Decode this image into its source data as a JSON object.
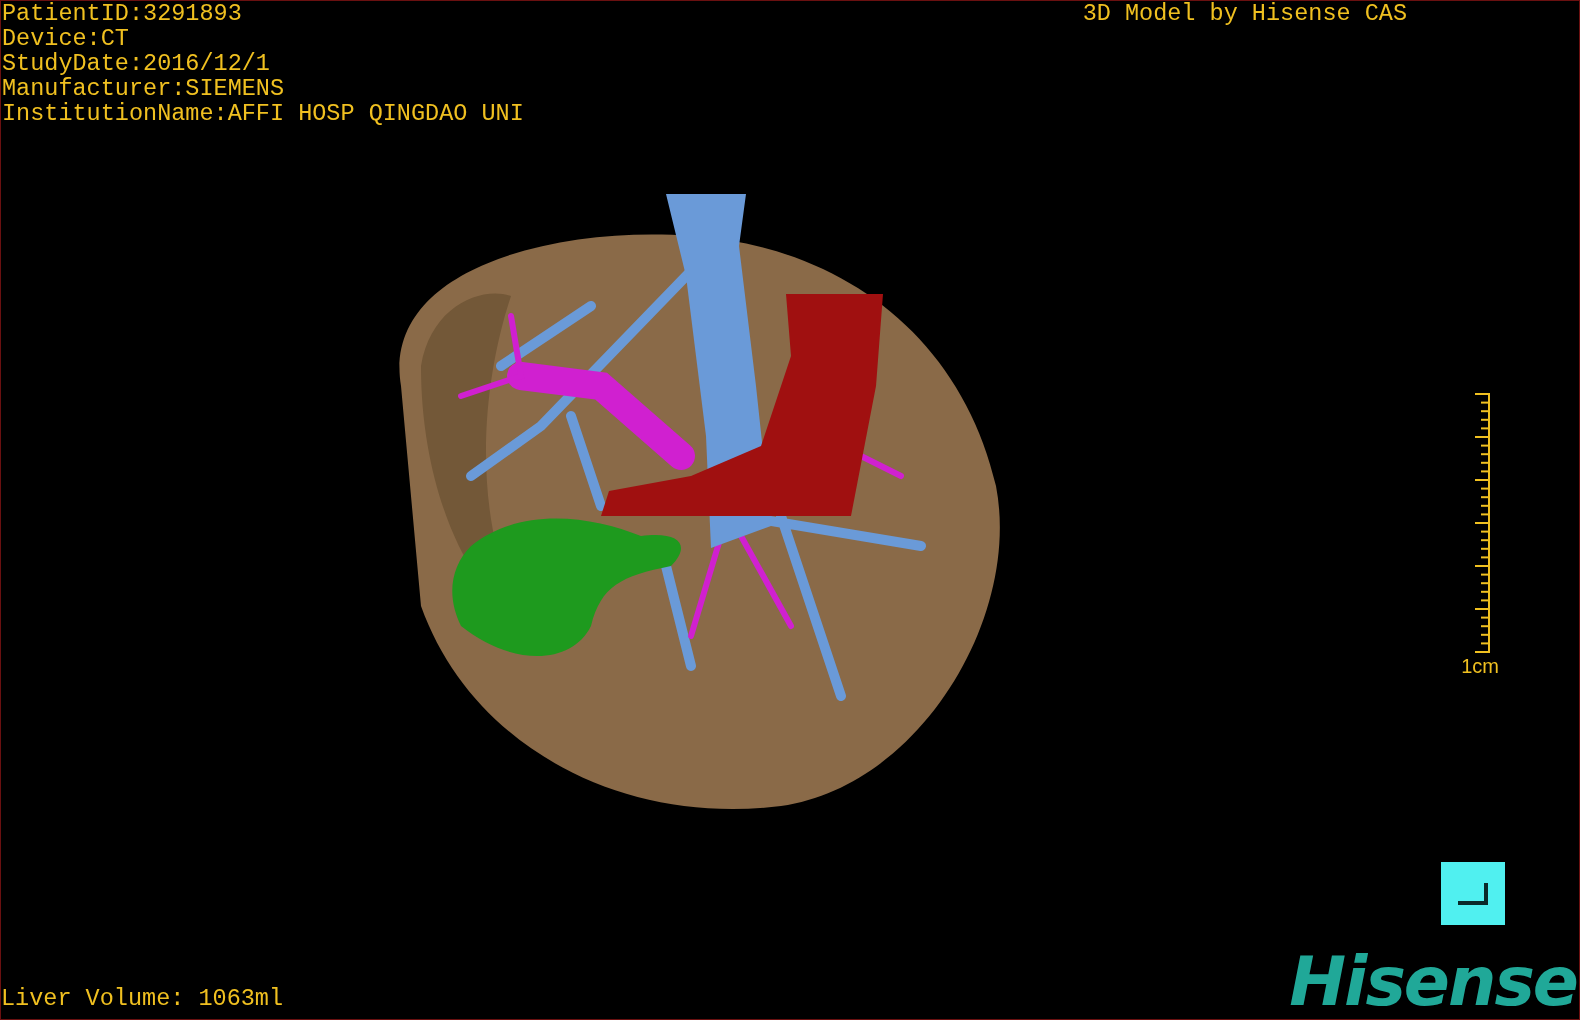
{
  "study_info": [
    "PatientID:3291893",
    "Device:CT",
    "StudyDate:2016/12/1",
    "Manufacturer:SIEMENS",
    "InstitutionName:AFFI HOSP QINGDAO UNI"
  ],
  "title": "3D Model by Hisense CAS",
  "scale_bar": {
    "label": "1cm"
  },
  "liver_volume": "Liver Volume: 1063ml",
  "logo": "Hisense"
}
